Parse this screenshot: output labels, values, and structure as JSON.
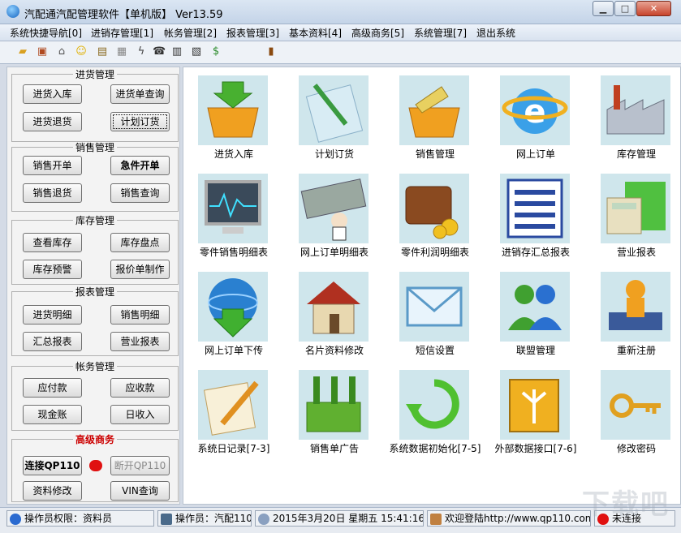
{
  "window": {
    "title": "汽配通汽配管理软件【单机版】 Ver13.59",
    "min_label": "▁",
    "max_label": "□",
    "close_label": "✕"
  },
  "menu": [
    "系统快捷导航[0]",
    "进销存管理[1]",
    "帐务管理[2]",
    "报表管理[3]",
    "基本资料[4]",
    "高级商务[5]",
    "系统管理[7]",
    "退出系统"
  ],
  "toolbar_icons": [
    "open-folder-icon",
    "box-icon",
    "bank-icon",
    "smiley-icon",
    "book-icon",
    "document-icon",
    "lightning-icon",
    "phone-icon",
    "calculator-icon",
    "film-icon",
    "money-bag-icon",
    "exit-door-icon"
  ],
  "left": {
    "purchase": {
      "title": "进货管理",
      "b1": "进货入库",
      "b2": "进货单查询",
      "b3": "进货退货",
      "b4": "计划订货"
    },
    "sales": {
      "title": "销售管理",
      "b1": "销售开单",
      "b2": "急件开单",
      "b3": "销售退货",
      "b4": "销售查询"
    },
    "stock": {
      "title": "库存管理",
      "b1": "查看库存",
      "b2": "库存盘点",
      "b3": "库存预警",
      "b4": "报价单制作"
    },
    "report": {
      "title": "报表管理",
      "b1": "进货明细",
      "b2": "销售明细",
      "b3": "汇总报表",
      "b4": "营业报表"
    },
    "account": {
      "title": "帐务管理",
      "b1": "应付款",
      "b2": "应收款",
      "b3": "现金账",
      "b4": "日收入"
    },
    "business": {
      "title": "高级商务",
      "b1": "连接QP110",
      "b2": "断开QP110",
      "b3": "资料修改",
      "b4": "VIN查询"
    }
  },
  "tiles": [
    {
      "label": "进货入库",
      "icon": "basket-in-icon"
    },
    {
      "label": "计划订货",
      "icon": "notepad-icon"
    },
    {
      "label": "销售管理",
      "icon": "basket-out-icon"
    },
    {
      "label": "网上订单",
      "icon": "internet-explorer-icon"
    },
    {
      "label": "库存管理",
      "icon": "factory-icon"
    },
    {
      "label": "零件销售明细表",
      "icon": "monitor-chart-icon"
    },
    {
      "label": "网上订单明细表",
      "icon": "laboratory-sign-icon"
    },
    {
      "label": "零件利润明细表",
      "icon": "wallet-icon"
    },
    {
      "label": "进销存汇总报表",
      "icon": "list-document-icon"
    },
    {
      "label": "营业报表",
      "icon": "calculator-folder-icon"
    },
    {
      "label": "网上订单下传",
      "icon": "globe-download-icon"
    },
    {
      "label": "名片资料修改",
      "icon": "house-icon"
    },
    {
      "label": "短信设置",
      "icon": "envelope-icon"
    },
    {
      "label": "联盟管理",
      "icon": "users-icon"
    },
    {
      "label": "重新注册",
      "icon": "user-book-icon"
    },
    {
      "label": "系统日记录[7-3]",
      "icon": "pencil-notes-icon"
    },
    {
      "label": "销售单广告",
      "icon": "bottle-crate-icon"
    },
    {
      "label": "系统数据初始化[7-5]",
      "icon": "refresh-icon"
    },
    {
      "label": "外部数据接口[7-6]",
      "icon": "interface-book-icon"
    },
    {
      "label": "修改密码",
      "icon": "keys-icon"
    }
  ],
  "status": {
    "permission": "操作员权限：资料员",
    "operator": "操作员：汽配110",
    "datetime": "2015年3月20日  星期五 15:41:16",
    "welcome": "欢迎登陆http://www.qp110.com",
    "connection": "未连接"
  },
  "watermark": "下载吧",
  "colors": {
    "tile_bg": "#cfe6ec",
    "accent": "#1464c0",
    "status_red": "#e01010",
    "business_title": "#cc0000"
  }
}
